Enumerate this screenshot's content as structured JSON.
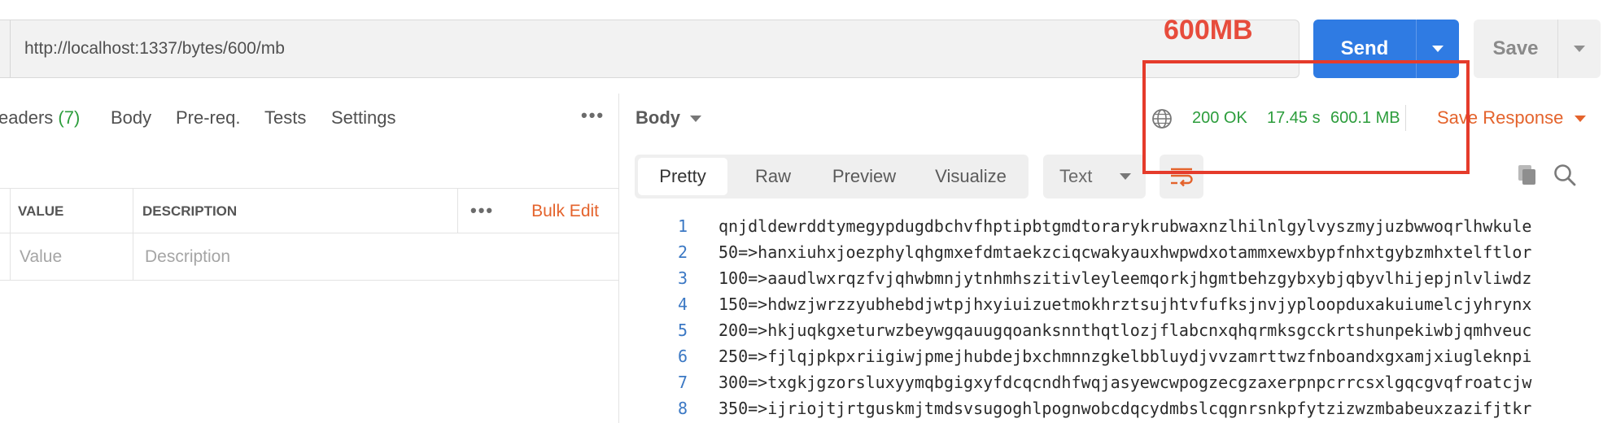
{
  "request": {
    "url": "http://localhost:1337/bytes/600/mb",
    "send_label": "Send",
    "save_label": "Save"
  },
  "annotation": {
    "label": "600MB",
    "color": "#e53b2b"
  },
  "request_tabs": {
    "headers_label": "eaders",
    "headers_count": "(7)",
    "body": "Body",
    "prereq": "Pre-req.",
    "tests": "Tests",
    "settings": "Settings"
  },
  "params": {
    "columns": [
      "VALUE",
      "DESCRIPTION"
    ],
    "bulk_edit": "Bulk Edit",
    "placeholders": {
      "value": "Value",
      "description": "Description"
    }
  },
  "response": {
    "body_select": "Body",
    "status": "200 OK",
    "time": "17.45 s",
    "size": "600.1 MB",
    "save_response": "Save Response",
    "format_tabs": [
      "Pretty",
      "Raw",
      "Preview",
      "Visualize"
    ],
    "active_format": "Pretty",
    "language": "Text",
    "lines": [
      {
        "n": "1",
        "text": "qnjdldewrddtymegypdugdbchvfhptipbtgmdtorarykrubwaxnzlhilnlgylvyszmyjuzbwwoqrlhwkule"
      },
      {
        "n": "2",
        "text": "50=>hanxiuhxjoezphylqhgmxefdmtaekzciqcwakyauxhwpwdxotammxewxbypfnhxtgybzmhxtelftlor"
      },
      {
        "n": "3",
        "text": "100=>aaudlwxrqzfvjqhwbmnjytnhmhszitivleyleemqorkjhgmtbehzgybxybjqbyvlhijepjnlvliwdz"
      },
      {
        "n": "4",
        "text": "150=>hdwzjwrzzyubhebdjwtpjhxyiuizuetmokhrztsujhtvfufksjnvjyploopduxakuiumelcjyhrynx"
      },
      {
        "n": "5",
        "text": "200=>hkjuqkgxeturwzbeywgqauugqoanksnnthqtlozjflabcnxqhqrmksgcckrtshunpekiwbjqmhveuc"
      },
      {
        "n": "6",
        "text": "250=>fjlqjpkpxriigiwjpmejhubdejbxchmnnzgkelbbluydjvvzamrttwzfnboandxgxamjxiugleknpi"
      },
      {
        "n": "7",
        "text": "300=>txgkjgzorsluxyymqbgigxyfdcqcndhfwqjasyewcwpogzecgzaxerpnpcrrcsxlgqcgvqfroatcjw"
      },
      {
        "n": "8",
        "text": "350=>ijriojtjrtguskmjtmdsvsugoghlpognwobcdqcydmbslcqgnrsnkpfytzizwzmbabeuxzazifjtkr"
      }
    ]
  },
  "colors": {
    "accent_blue": "#2f7be3",
    "accent_orange": "#e4632c",
    "status_green": "#2c9d3c"
  }
}
